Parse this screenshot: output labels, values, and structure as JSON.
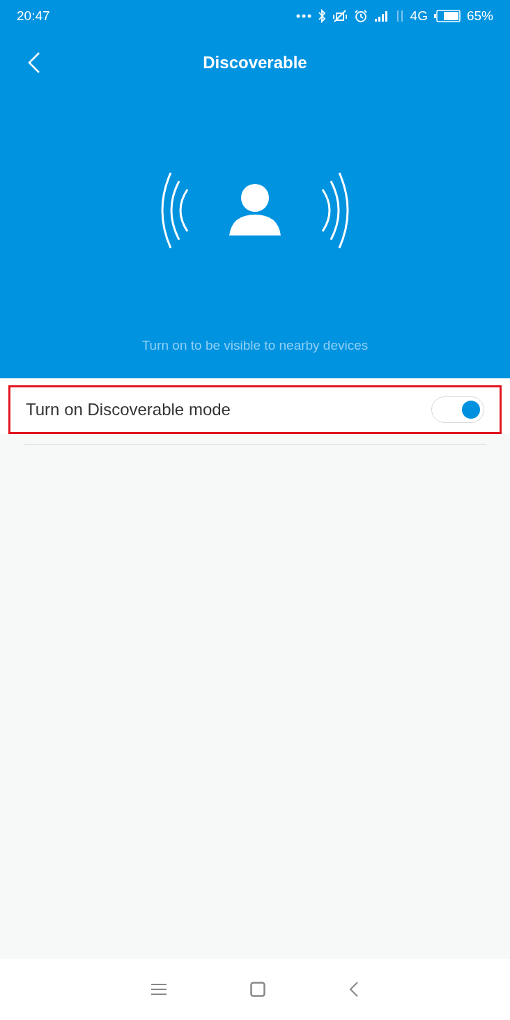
{
  "status_bar": {
    "time": "20:47",
    "network": "4G",
    "battery": "65%"
  },
  "header": {
    "title": "Discoverable",
    "caption": "Turn on to be visible to nearby devices"
  },
  "setting": {
    "label": "Turn on Discoverable mode",
    "on": true,
    "highlighted": true
  }
}
